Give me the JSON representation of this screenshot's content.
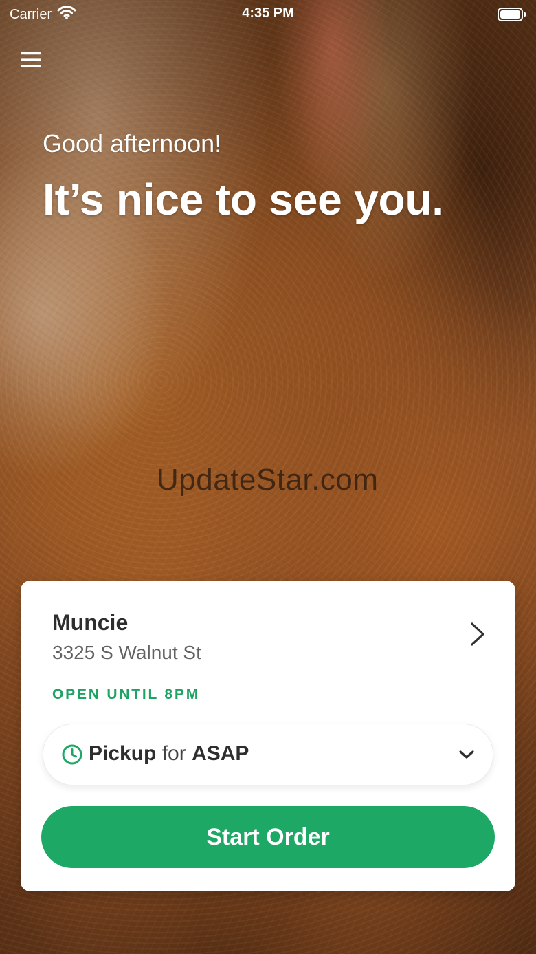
{
  "status_bar": {
    "carrier": "Carrier",
    "time": "4:35 PM",
    "wifi_icon": "wifi-icon",
    "battery_icon": "battery-icon"
  },
  "navigation": {
    "menu_icon": "hamburger-menu-icon"
  },
  "hero": {
    "greeting": "Good afternoon!",
    "headline": "It’s nice to see you."
  },
  "watermark": {
    "text": "UpdateStar.com"
  },
  "location_card": {
    "name": "Muncie",
    "address": "3325 S Walnut St",
    "hours_status": "OPEN UNTIL 8PM",
    "arrow_icon": "chevron-right-icon"
  },
  "order_method": {
    "clock_icon": "clock-icon",
    "mode": "Pickup",
    "connector": "for",
    "time": "ASAP",
    "dropdown_icon": "chevron-down-icon"
  },
  "actions": {
    "start_order_label": "Start Order"
  },
  "colors": {
    "accent_green": "#1da866",
    "status_green": "#1ea365",
    "card_background": "#ffffff",
    "primary_text": "#2e2e2e",
    "secondary_text": "#626262"
  }
}
